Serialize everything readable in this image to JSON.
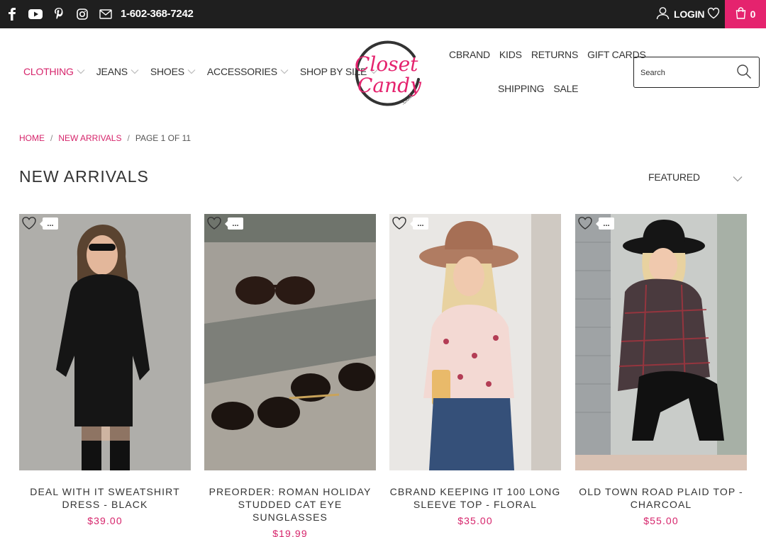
{
  "topbar": {
    "phone": "1-602-368-7242",
    "login_label": "LOGIN",
    "cart_count": "0",
    "accent_color": "#e5236e",
    "social_icons": [
      "facebook-icon",
      "youtube-icon",
      "pinterest-icon",
      "instagram-icon",
      "mail-icon"
    ]
  },
  "nav": {
    "left": [
      {
        "label": "CLOTHING",
        "active": true
      },
      {
        "label": "JEANS"
      },
      {
        "label": "SHOES"
      },
      {
        "label": "ACCESSORIES"
      },
      {
        "label": "SHOP BY SIZE"
      }
    ],
    "right_row1": [
      "CBRAND",
      "KIDS",
      "RETURNS",
      "GIFT CARDS"
    ],
    "right_row2": [
      "SHIPPING",
      "SALE"
    ]
  },
  "logo": {
    "line1": "Closet",
    "line2": "Candy",
    "suffix": ".COM"
  },
  "search": {
    "placeholder": "Search"
  },
  "breadcrumb": {
    "home": "HOME",
    "section": "NEW ARRIVALS",
    "current": "PAGE 1 OF 11"
  },
  "page": {
    "title": "NEW ARRIVALS",
    "sort_label": "FEATURED"
  },
  "products": [
    {
      "name": "DEAL WITH IT SWEATSHIRT DRESS - BLACK",
      "price": "$39.00",
      "more": "..."
    },
    {
      "name": "PREORDER: ROMAN HOLIDAY STUDDED CAT EYE SUNGLASSES",
      "price": "$19.99",
      "more": "..."
    },
    {
      "name": "CBRAND KEEPING IT 100 LONG SLEEVE TOP - FLORAL",
      "price": "$35.00",
      "more": "..."
    },
    {
      "name": "OLD TOWN ROAD PLAID TOP - CHARCOAL",
      "price": "$55.00",
      "more": "..."
    }
  ]
}
